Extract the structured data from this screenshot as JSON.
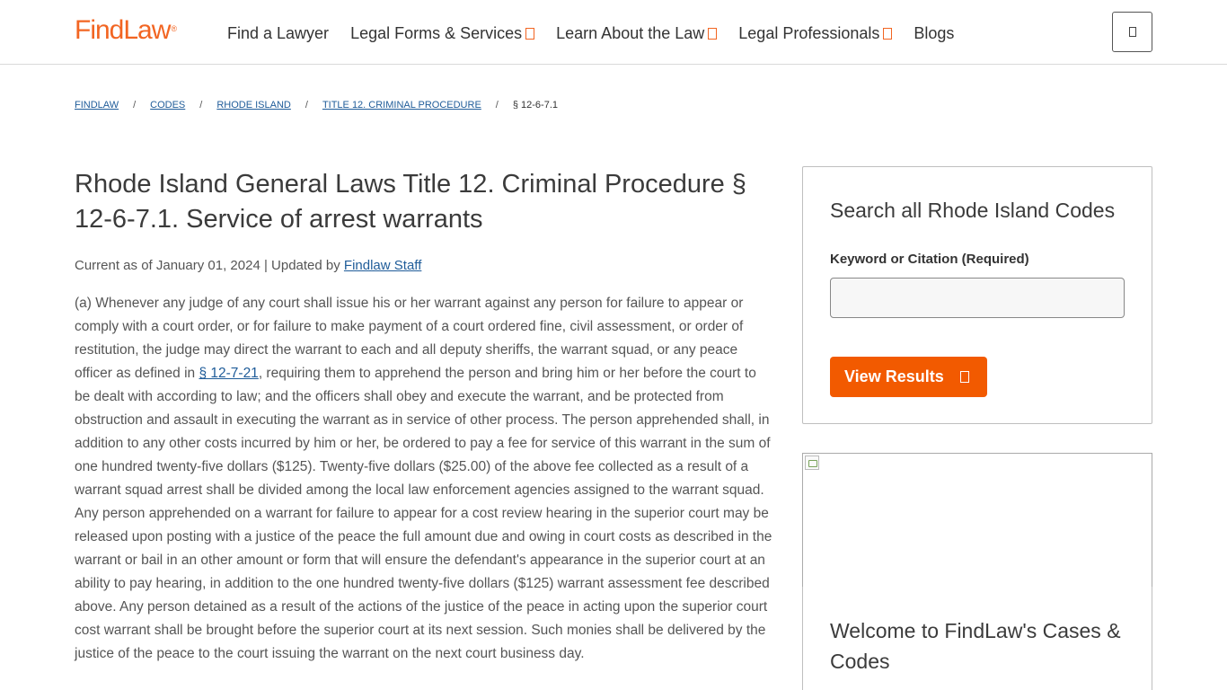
{
  "header": {
    "logo_text": "FindLaw",
    "logo_mark": "®",
    "nav": [
      {
        "label": "Find a Lawyer",
        "has_caret": false
      },
      {
        "label": "Legal Forms & Services",
        "has_caret": true
      },
      {
        "label": "Learn About the Law",
        "has_caret": true
      },
      {
        "label": "Legal Professionals",
        "has_caret": true
      },
      {
        "label": "Blogs",
        "has_caret": false
      }
    ],
    "menu_icon": "menu-icon"
  },
  "breadcrumb": {
    "items": [
      "FINDLAW",
      "CODES",
      "RHODE ISLAND",
      "TITLE 12. CRIMINAL PROCEDURE"
    ],
    "separator": "/",
    "current": "§ 12-6-7.1"
  },
  "article": {
    "title": "Rhode Island General Laws Title 12. Criminal Procedure § 12-6-7.1. Service of arrest warrants",
    "meta_prefix": "Current as of January 01, 2024 | Updated by ",
    "meta_author": "Findlaw Staff",
    "body_part1": "(a) Whenever any judge of any court shall issue his or her warrant against any person for failure to appear or comply with a court order, or for failure to make payment of a court ordered fine, civil assessment, or order of restitution, the judge may direct the warrant to each and all deputy sheriffs, the warrant squad, or any peace officer as defined in ",
    "body_link": "§ 12-7-21",
    "body_part2": ", requiring them to apprehend the person and bring him or her before the court to be dealt with according to law; and the officers shall obey and execute the warrant, and be protected from obstruction and assault in executing the warrant as in service of other process. The person apprehended shall, in addition to any other costs incurred by him or her, be ordered to pay a fee for service of this warrant in the sum of one hundred twenty-five dollars ($125). Twenty-five dollars ($25.00) of the above fee collected as a result of a warrant squad arrest shall be divided among the local law enforcement agencies assigned to the warrant squad. Any person apprehended on a warrant for failure to appear for a cost review hearing in the superior court may be released upon posting with a justice of the peace the full amount due and owing in court costs as described in the warrant or bail in an other amount or form that will ensure the defendant's appearance in the superior court at an ability to pay hearing, in addition to the one hundred twenty-five dollars ($125) warrant assessment fee described above. Any person detained as a result of the actions of the justice of the peace in acting upon the superior court cost warrant shall be brought before the superior court at its next session. Such monies shall be delivered by the justice of the peace to the court issuing the warrant on the next court business day."
  },
  "sidebar": {
    "search": {
      "title": "Search all Rhode Island Codes",
      "label": "Keyword or Citation (Required)",
      "placeholder": "",
      "button_label": "View Results"
    },
    "welcome_title": "Welcome to FindLaw's Cases & Codes"
  },
  "colors": {
    "brand_orange": "#f26522",
    "button_orange": "#f25a00",
    "link_blue": "#1f5c99"
  }
}
